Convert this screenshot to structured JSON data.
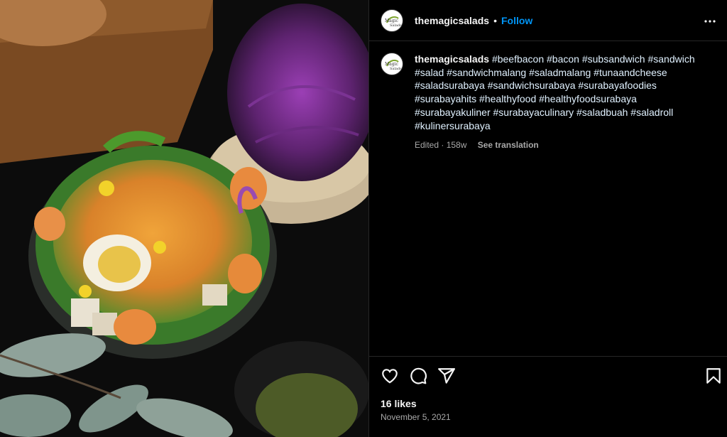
{
  "post": {
    "username": "themagicsalads",
    "follow_label": "Follow",
    "separator": "•",
    "avatar_text": "Magic Salads",
    "caption": {
      "username": "themagicsalads",
      "hashtags": "#beefbacon #bacon #subsandwich #sandwich #salad #sandwichmalang #saladmalang #tunaandcheese #saladsurabaya #sandwichsurabaya #surabayafoodies #surabayahits #healthyfood #healthyfoodsurabaya #surabayakuliner #surabayaculinary #saladbuah #saladroll #kulinersurabaya",
      "edited": "Edited · 158w",
      "see_translation": "See translation"
    },
    "likes": "16 likes",
    "date": "November 5, 2021"
  },
  "icons": {
    "more": "more-options-icon",
    "like": "heart-icon",
    "comment": "comment-icon",
    "share": "share-icon",
    "save": "bookmark-icon"
  },
  "colors": {
    "background": "#000000",
    "follow": "#0095f6",
    "secondary_text": "#a8a8a8",
    "border": "#262626"
  }
}
